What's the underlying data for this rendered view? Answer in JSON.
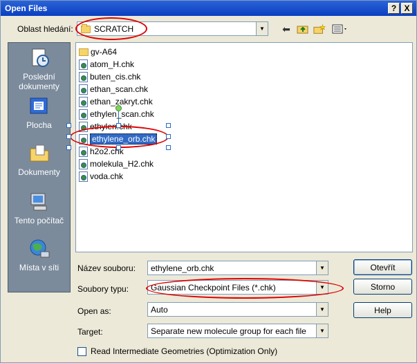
{
  "window": {
    "title": "Open Files",
    "help_button": "?",
    "close_button": "X"
  },
  "lookin": {
    "label": "Oblast hledání:",
    "value": "SCRATCH"
  },
  "places": [
    {
      "label": "Poslední dokumenty",
      "icon": "recent-documents-icon"
    },
    {
      "label": "Plocha",
      "icon": "desktop-icon"
    },
    {
      "label": "Dokumenty",
      "icon": "documents-folder-icon"
    },
    {
      "label": "Tento počítač",
      "icon": "my-computer-icon"
    },
    {
      "label": "Místa v síti",
      "icon": "network-places-icon"
    }
  ],
  "files": [
    {
      "name": "gv-A64",
      "type": "folder"
    },
    {
      "name": "atom_H.chk",
      "type": "file"
    },
    {
      "name": "buten_cis.chk",
      "type": "file"
    },
    {
      "name": "ethan_scan.chk",
      "type": "file"
    },
    {
      "name": "ethan_zakryt.chk",
      "type": "file"
    },
    {
      "name": "ethylen_scan.chk",
      "type": "file"
    },
    {
      "name": "ethylen.chk",
      "type": "file"
    },
    {
      "name": "ethylene_orb.chk",
      "type": "file",
      "selected": true
    },
    {
      "name": "h2o2.chk",
      "type": "file"
    },
    {
      "name": "molekula_H2.chk",
      "type": "file"
    },
    {
      "name": "voda.chk",
      "type": "file"
    }
  ],
  "form": {
    "filename_label": "Název souboru:",
    "filename_value": "ethylene_orb.chk",
    "filetype_label": "Soubory typu:",
    "filetype_value": "Gaussian Checkpoint Files (*.chk)",
    "openas_label": "Open as:",
    "openas_value": "Auto",
    "target_label": "Target:",
    "target_value": "Separate new molecule group for each file",
    "checkbox_label": "Read Intermediate Geometries (Optimization Only)"
  },
  "buttons": {
    "open": "Otevřít",
    "cancel": "Storno",
    "help": "Help"
  },
  "colors": {
    "annotation": "#e00000",
    "selection": "#316ac5",
    "titlebar": "#0a3fc0"
  }
}
